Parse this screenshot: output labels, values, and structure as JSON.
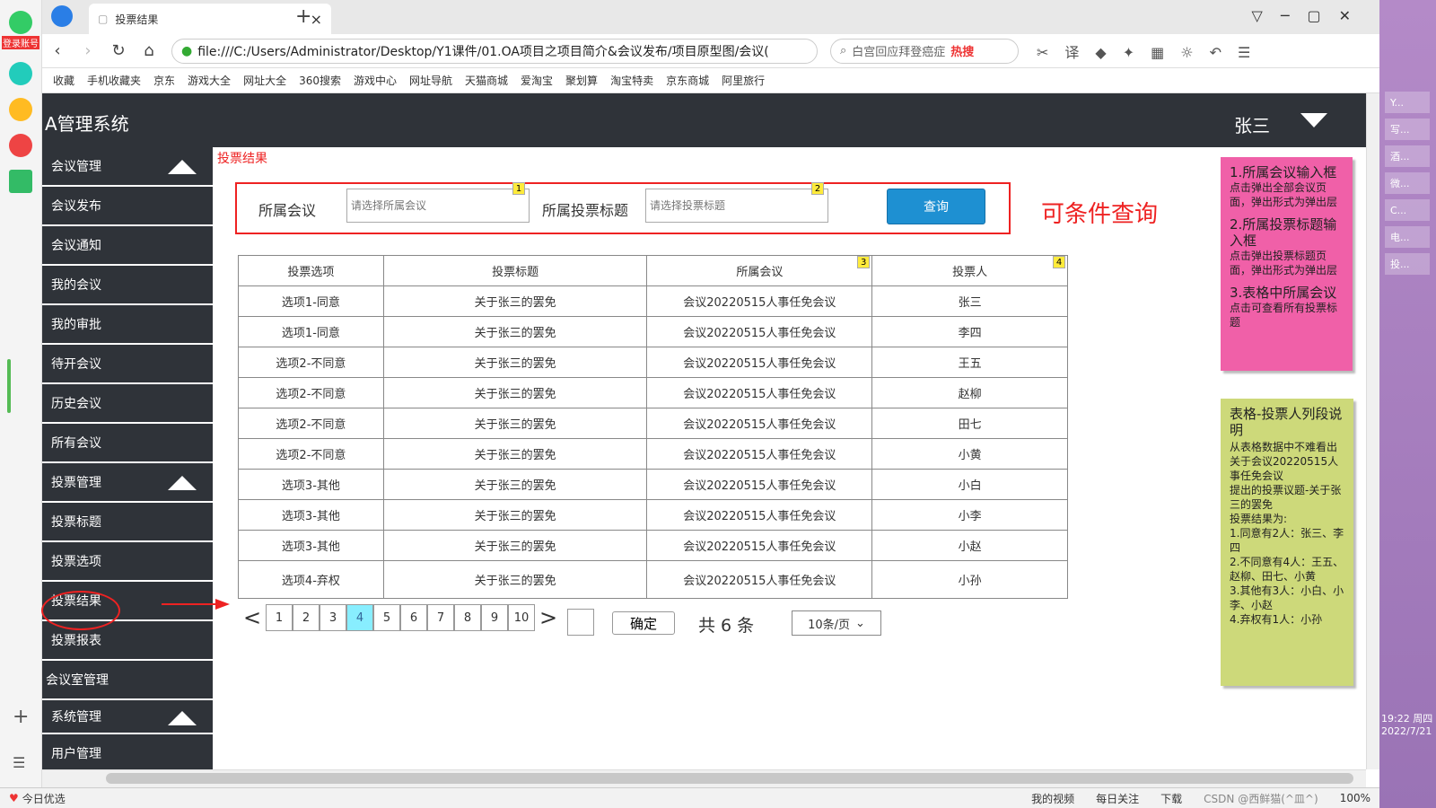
{
  "browser": {
    "tab_title": "投票结果",
    "address": "file:///C:/Users/Administrator/Desktop/Y1课件/01.OA项目之项目简介&会议发布/项目原型图/会议(",
    "search_hint": "白宫回应拜登癌症",
    "hot_label": "热搜",
    "login_label": "登录账号",
    "bookmarks": [
      "收藏",
      "手机收藏夹",
      "京东",
      "游戏大全",
      "网址大全",
      "360搜索",
      "游戏中心",
      "网址导航",
      "天猫商城",
      "爱淘宝",
      "聚划算",
      "淘宝特卖",
      "京东商城",
      "阿里旅行"
    ],
    "status_left": "今日优选",
    "status_right": [
      "我的视频",
      "每日关注",
      "下载",
      "100%"
    ],
    "right_panel": [
      "Y...",
      "写...",
      "酒...",
      "微...",
      "C...",
      "电...",
      "投..."
    ],
    "clock": "19:22 周四",
    "date": "2022/7/21",
    "watermark": "CSDN @西鲜猫(^皿^)"
  },
  "app": {
    "title": "A管理系统",
    "user": "张三"
  },
  "sidebar": {
    "items": [
      "会议管理",
      "会议发布",
      "会议通知",
      "我的会议",
      "我的审批",
      "待开会议",
      "历史会议",
      "所有会议",
      "投票管理",
      "投票标题",
      "投票选项",
      "投票结果",
      "投票报表",
      "会议室管理",
      "系统管理",
      "用户管理"
    ]
  },
  "breadcrumb": "投票结果",
  "query": {
    "meeting_label": "所属会议",
    "meeting_placeholder": "请选择所属会议",
    "title_label": "所属投票标题",
    "title_placeholder": "请选择投票标题",
    "button": "查询",
    "badge1": "1",
    "badge2": "2",
    "note": "可条件查询"
  },
  "table": {
    "headers": [
      "投票选项",
      "投票标题",
      "所属会议",
      "投票人"
    ],
    "badge3": "3",
    "badge4": "4",
    "rows": [
      [
        "选项1-同意",
        "关于张三的罢免",
        "会议20220515人事任免会议",
        "张三"
      ],
      [
        "选项1-同意",
        "关于张三的罢免",
        "会议20220515人事任免会议",
        "李四"
      ],
      [
        "选项2-不同意",
        "关于张三的罢免",
        "会议20220515人事任免会议",
        "王五"
      ],
      [
        "选项2-不同意",
        "关于张三的罢免",
        "会议20220515人事任免会议",
        "赵柳"
      ],
      [
        "选项2-不同意",
        "关于张三的罢免",
        "会议20220515人事任免会议",
        "田七"
      ],
      [
        "选项2-不同意",
        "关于张三的罢免",
        "会议20220515人事任免会议",
        "小黄"
      ],
      [
        "选项3-其他",
        "关于张三的罢免",
        "会议20220515人事任免会议",
        "小白"
      ],
      [
        "选项3-其他",
        "关于张三的罢免",
        "会议20220515人事任免会议",
        "小李"
      ],
      [
        "选项3-其他",
        "关于张三的罢免",
        "会议20220515人事任免会议",
        "小赵"
      ],
      [
        "选项4-弃权",
        "关于张三的罢免",
        "会议20220515人事任免会议",
        "小孙"
      ]
    ]
  },
  "pager": {
    "prev": "<",
    "next": ">",
    "pages": [
      "1",
      "2",
      "3",
      "4",
      "5",
      "6",
      "7",
      "8",
      "9",
      "10"
    ],
    "current": "4",
    "confirm": "确定",
    "total": "共 6 条",
    "page_size": "10条/页"
  },
  "notes": {
    "pink": [
      {
        "title": "1.所属会议输入框",
        "sub": "点击弹出全部会议页面，弹出形式为弹出层"
      },
      {
        "title": "2.所属投票标题输入框",
        "sub": "点击弹出投票标题页面，弹出形式为弹出层"
      },
      {
        "title": "3.表格中所属会议",
        "sub": "点击可查看所有投票标题"
      }
    ],
    "green_title": "表格-投票人列段说明",
    "green_lines": [
      "从表格数据中不难看出关于会议20220515人事任免会议",
      "提出的投票议题-关于张三的罢免",
      "投票结果为:",
      "1.同意有2人：张三、李四",
      "2.不同意有4人：王五、赵柳、田七、小黄",
      "3.其他有3人：小白、小李、小赵",
      "4.弃权有1人：小孙"
    ]
  },
  "colors": {
    "accent": "#1e90d2",
    "dark": "#2f3339",
    "annotation": "#ee2222",
    "pink_note": "#f060a8",
    "green_note": "#cdd97a"
  }
}
